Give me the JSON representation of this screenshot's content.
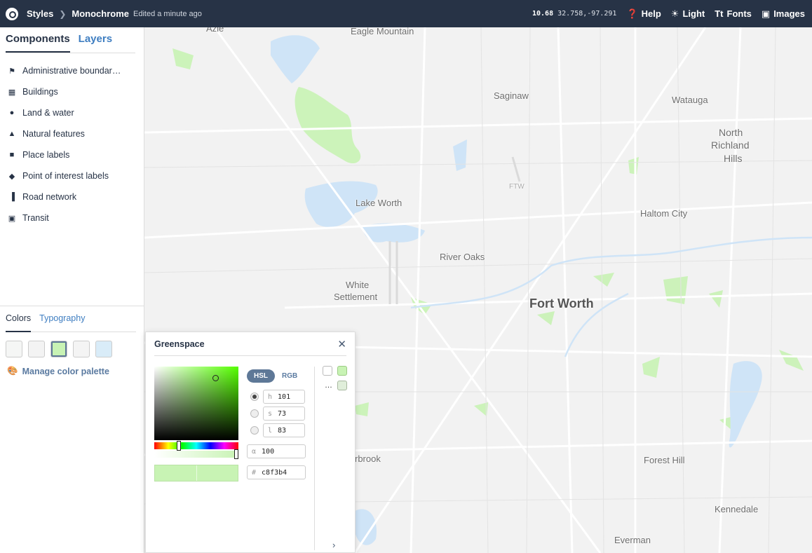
{
  "topbar": {
    "breadcrumb_styles": "Styles",
    "style_name": "Monochrome",
    "edited": "Edited a minute ago",
    "zoom": "10.68",
    "coords": "32.758,-97.291",
    "help": "Help",
    "theme": "Light",
    "fonts": "Fonts",
    "images": "Images"
  },
  "sidebar": {
    "tabs": [
      {
        "label": "Components"
      },
      {
        "label": "Layers"
      }
    ],
    "components": [
      {
        "label": "Administrative boundar…",
        "icon": "flag-icon"
      },
      {
        "label": "Buildings",
        "icon": "building-icon"
      },
      {
        "label": "Land & water",
        "icon": "globe-icon"
      },
      {
        "label": "Natural features",
        "icon": "natural-features-icon"
      },
      {
        "label": "Place labels",
        "icon": "place-icon"
      },
      {
        "label": "Point of interest labels",
        "icon": "marker-icon"
      },
      {
        "label": "Road network",
        "icon": "road-icon"
      },
      {
        "label": "Transit",
        "icon": "bus-icon"
      }
    ]
  },
  "colors": {
    "tabs": [
      {
        "label": "Colors"
      },
      {
        "label": "Typography"
      }
    ],
    "swatches": [
      "#f5f6f5",
      "#f3f3f3",
      "#c8f3b4",
      "#f4f4f4",
      "#d9ecf8"
    ],
    "manage": "Manage color palette"
  },
  "picker": {
    "title": "Greenspace",
    "modes": [
      "HSL",
      "RGB"
    ],
    "h_label": "h",
    "h": "101",
    "s_label": "s",
    "s": "73",
    "l_label": "l",
    "l": "83",
    "alpha_label": "α",
    "alpha": "100",
    "hex_label": "#",
    "hex": "c8f3b4",
    "color": "#c8f3b4",
    "ellipsis": "…"
  },
  "map": {
    "places": [
      {
        "label": "Azle"
      },
      {
        "label": "Eagle Mountain"
      },
      {
        "label": "Saginaw"
      },
      {
        "label": "Watauga"
      },
      {
        "label": "North"
      },
      {
        "label": "Richland"
      },
      {
        "label": "Hills"
      },
      {
        "label": "FTW"
      },
      {
        "label": "Lake Worth"
      },
      {
        "label": "Haltom City"
      },
      {
        "label": "River Oaks"
      },
      {
        "label": "White"
      },
      {
        "label": "Settlement"
      },
      {
        "label": "Fort Worth"
      },
      {
        "label": "rbrook"
      },
      {
        "label": "Forest Hill"
      },
      {
        "label": "Kennedale"
      },
      {
        "label": "Everman"
      }
    ]
  }
}
